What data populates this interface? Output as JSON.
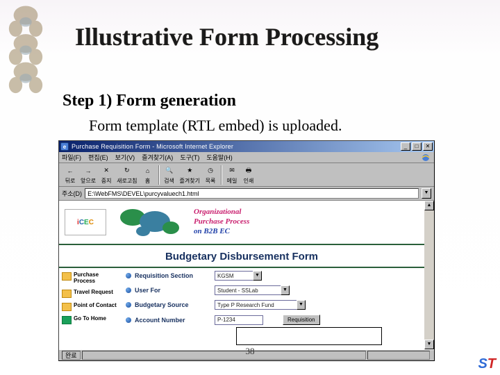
{
  "slide": {
    "title": "Illustrative Form Processing",
    "step_heading": "Step 1) Form generation",
    "step_desc": "Form template (RTL embed) is uploaded.",
    "page_number": "38"
  },
  "browser": {
    "window_title": "Purchase Requisition Form - Microsoft Internet Explorer",
    "menus": [
      "파일(F)",
      "편집(E)",
      "보기(V)",
      "즐겨찾기(A)",
      "도구(T)",
      "도움말(H)"
    ],
    "toolbar": [
      {
        "icon": "←",
        "label": "뒤로"
      },
      {
        "icon": "→",
        "label": "앞으로"
      },
      {
        "icon": "✕",
        "label": "중지"
      },
      {
        "icon": "↻",
        "label": "새로고침"
      },
      {
        "icon": "⌂",
        "label": "홈"
      },
      {
        "icon": "🔍",
        "label": "검색"
      },
      {
        "icon": "★",
        "label": "즐겨찾기"
      },
      {
        "icon": "◷",
        "label": "목록"
      },
      {
        "icon": "✉",
        "label": "메일"
      },
      {
        "icon": "🖶",
        "label": "인쇄"
      }
    ],
    "address_label": "주소(D)",
    "address_value": "E:\\WebFMS\\DEVEL\\purcyvaluech1.html",
    "statusbar": "완료"
  },
  "page": {
    "logo_text": "iCEC",
    "banner_line1": "Organizational",
    "banner_line2": "Purchase Process",
    "banner_line3": "on B2B EC",
    "form_title": "Budgetary Disbursement Form",
    "nav": [
      {
        "label": "Purchase Process"
      },
      {
        "label": "Travel Request"
      },
      {
        "label": "Point of Contact"
      },
      {
        "label": "Go To Home"
      }
    ],
    "rows": [
      {
        "label": "Requisition Section",
        "type": "select",
        "value": "KGSM"
      },
      {
        "label": "User For",
        "type": "select",
        "value": "Student - SSLab"
      },
      {
        "label": "Budgetary Source",
        "type": "select",
        "value": "Type P Research Fund"
      },
      {
        "label": "Account Number",
        "type": "text",
        "value": "P-1234",
        "button": "Requisition"
      }
    ]
  },
  "corner_logo": "ST"
}
